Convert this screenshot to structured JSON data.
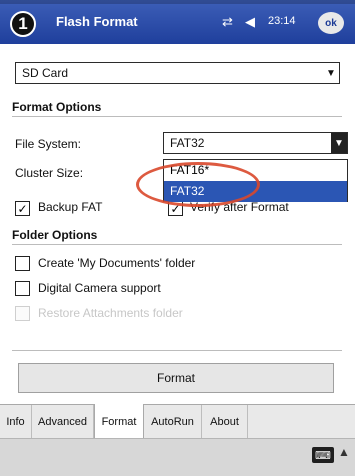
{
  "annotation": {
    "step_number": "1"
  },
  "statusbar": {
    "app_title": "Flash Format",
    "signal_icon": "signal-icon",
    "speaker_icon": "speaker-icon",
    "time": "23:14",
    "ok_label": "ok"
  },
  "storage": {
    "selected": "SD Card"
  },
  "format_options": {
    "heading": "Format Options",
    "file_system_label": "File System:",
    "file_system_value": "FAT32",
    "cluster_size_label": "Cluster Size:",
    "backup_fat_label": "Backup FAT",
    "verify_label": "Verify after Format"
  },
  "file_system_list": [
    "FAT16*",
    "FAT32"
  ],
  "folder_options": {
    "heading": "Folder Options",
    "create_my_documents": "Create 'My Documents' folder",
    "digital_camera": "Digital Camera support",
    "restore_attachments": "Restore Attachments folder"
  },
  "actions": {
    "format": "Format"
  },
  "tabs": [
    "Info",
    "Advanced",
    "Format",
    "AutoRun",
    "About"
  ],
  "bottom": {
    "keyboard_icon": "keyboard-icon"
  }
}
